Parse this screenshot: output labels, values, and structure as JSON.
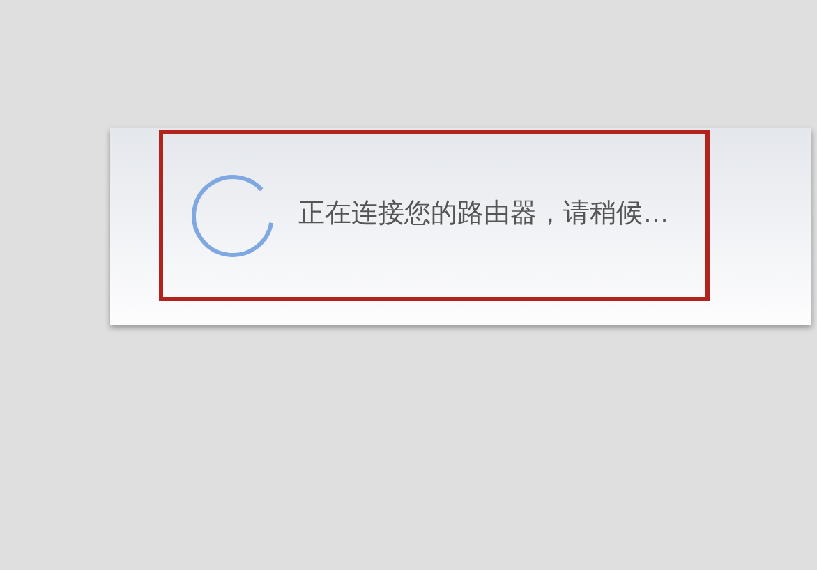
{
  "dialog": {
    "loading": true,
    "message": "正在连接您的路由器，请稍候…"
  },
  "annotation": {
    "highlighted": true
  }
}
